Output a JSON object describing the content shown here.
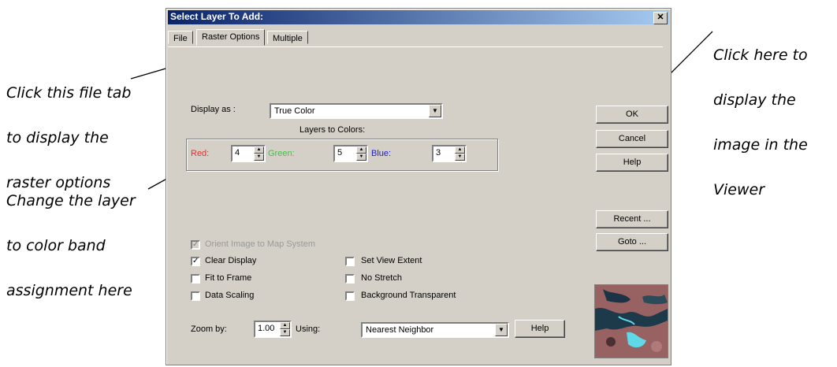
{
  "annotations": {
    "tab_note": [
      "Click this file tab",
      "to display the",
      "raster options"
    ],
    "band_note": [
      "Change the layer",
      "to color band",
      "assignment here"
    ],
    "ok_note": [
      "Click here to",
      "display the",
      "image in the",
      "Viewer"
    ]
  },
  "dialog": {
    "title": "Select Layer To Add:",
    "close_symbol": "✕",
    "tabs": [
      "File",
      "Raster Options",
      "Multiple"
    ],
    "display_as_label": "Display as :",
    "display_as_value": "True Color",
    "layers_to_colors_label": "Layers to Colors:",
    "bands": [
      {
        "label": "Red:",
        "value": "4",
        "color": "#e03030"
      },
      {
        "label": "Green:",
        "value": "5",
        "color": "#33cc33"
      },
      {
        "label": "Blue:",
        "value": "3",
        "color": "#2020d0"
      }
    ],
    "checkboxes": [
      {
        "label": "Orient Image to Map System",
        "checked": true,
        "disabled": true
      },
      {
        "label": "Clear Display",
        "checked": true,
        "disabled": false
      },
      {
        "label": "Set View Extent",
        "checked": false,
        "disabled": false
      },
      {
        "label": "Fit to Frame",
        "checked": false,
        "disabled": false
      },
      {
        "label": "No Stretch",
        "checked": false,
        "disabled": false
      },
      {
        "label": "Data Scaling",
        "checked": false,
        "disabled": false
      },
      {
        "label": "Background Transparent",
        "checked": false,
        "disabled": false
      }
    ],
    "zoom_label": "Zoom by:",
    "zoom_value": "1.00",
    "using_label": "Using:",
    "using_value": "Nearest Neighbor",
    "help_small": "Help",
    "buttons": {
      "ok": "OK",
      "cancel": "Cancel",
      "help": "Help",
      "recent": "Recent ...",
      "goto": "Goto ..."
    },
    "check_mark": "✓"
  }
}
